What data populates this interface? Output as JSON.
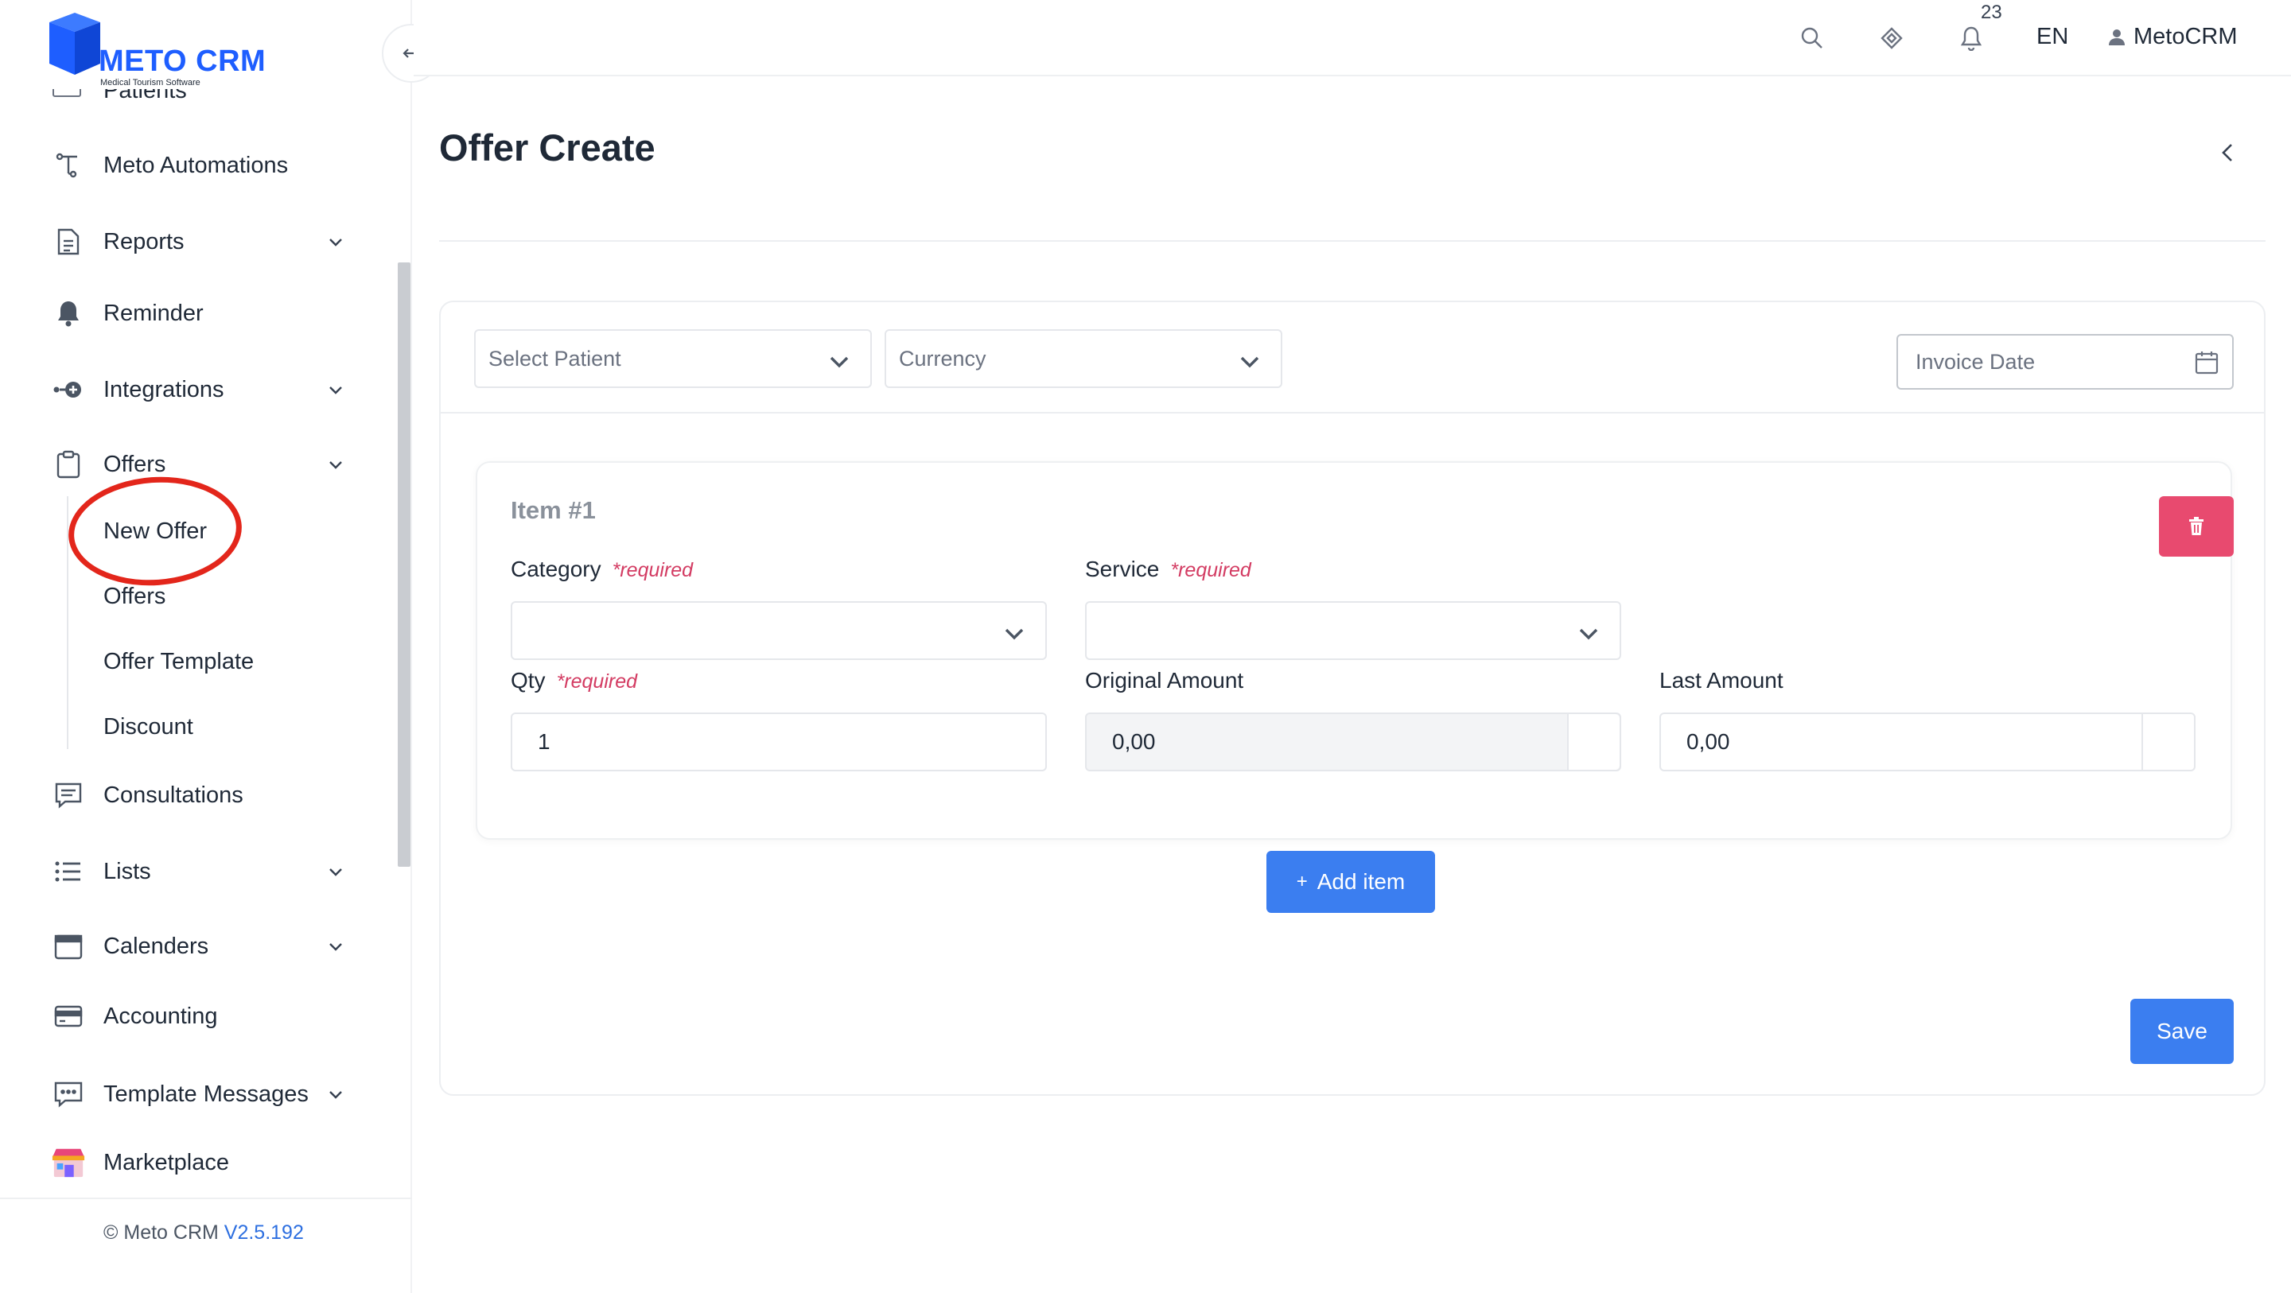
{
  "brand": {
    "name": "METO CRM",
    "tagline": "Medical Tourism Software",
    "color": "#1e5eff"
  },
  "sidebar": {
    "cut_item_label": "Patients",
    "items": [
      {
        "label": "Meto Automations",
        "icon": "automation-icon"
      },
      {
        "label": "Reports",
        "icon": "document-icon"
      },
      {
        "label": "Reminder",
        "icon": "bell-icon"
      },
      {
        "label": "Integrations",
        "icon": "plug-icon"
      },
      {
        "label": "Offers",
        "icon": "clipboard-icon"
      },
      {
        "label": "Consultations",
        "icon": "chat-icon"
      },
      {
        "label": "Lists",
        "icon": "list-icon"
      },
      {
        "label": "Calenders",
        "icon": "calendar-icon"
      },
      {
        "label": "Accounting",
        "icon": "card-icon"
      },
      {
        "label": "Template Messages",
        "icon": "message-icon"
      },
      {
        "label": "Marketplace",
        "icon": "store-icon"
      }
    ],
    "offers_sub": [
      "New Offer",
      "Offers",
      "Offer Template",
      "Discount"
    ],
    "footer": {
      "copyright": "© Meto CRM",
      "version": "V2.5.192"
    }
  },
  "topbar": {
    "notification_count": "23",
    "language": "EN",
    "user": "MetoCRM"
  },
  "page": {
    "title": "Offer Create"
  },
  "form": {
    "patient_placeholder": "Select Patient",
    "currency_placeholder": "Currency",
    "invoice_date_placeholder": "Invoice Date",
    "item": {
      "title": "Item #1",
      "category_label": "Category",
      "service_label": "Service",
      "qty_label": "Qty",
      "required_text": "*required",
      "original_amount_label": "Original Amount",
      "last_amount_label": "Last Amount",
      "qty_value": "1",
      "original_amount_value": "0,00",
      "last_amount_value": "0,00"
    },
    "add_item_label": "Add item",
    "save_label": "Save"
  },
  "colors": {
    "primary": "#3b7ef0",
    "danger": "#e84a6f",
    "highlight_ring": "#e3261b"
  }
}
